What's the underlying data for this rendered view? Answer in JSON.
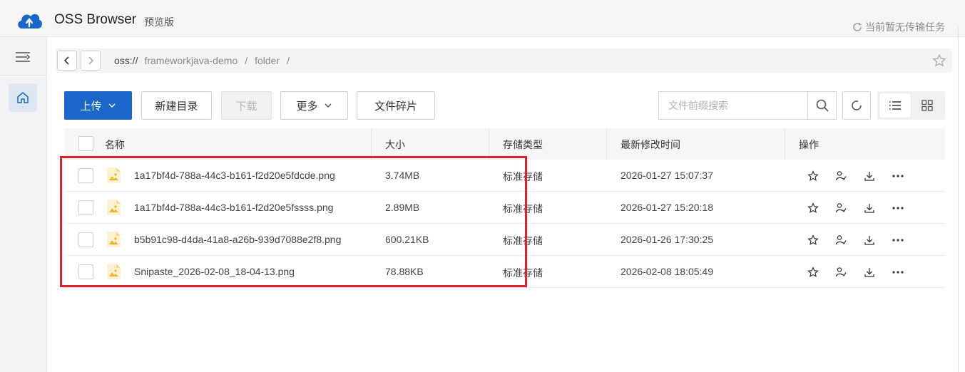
{
  "app": {
    "name": "OSS Browser",
    "tag": "预览版",
    "transfer_status": "当前暂无传输任务",
    "brand_color": "#1a66c9"
  },
  "address": {
    "scheme": "oss://",
    "segments": [
      "frameworkjava-demo",
      "folder"
    ],
    "separator": "/"
  },
  "toolbar": {
    "upload_label": "上传",
    "new_dir_label": "新建目录",
    "download_label": "下载",
    "more_label": "更多",
    "fragments_label": "文件碎片",
    "search_placeholder": "文件前缀搜索"
  },
  "table": {
    "columns": {
      "name": "名称",
      "size": "大小",
      "storage": "存储类型",
      "time": "最新修改时间",
      "actions": "操作"
    },
    "rows": [
      {
        "name": "1a17bf4d-788a-44c3-b161-f2d20e5fdcde.png",
        "size": "3.74MB",
        "storage": "标准存储",
        "time": "2026-01-27 15:07:37"
      },
      {
        "name": "1a17bf4d-788a-44c3-b161-f2d20e5fssss.png",
        "size": "2.89MB",
        "storage": "标准存储",
        "time": "2026-01-27 15:20:18"
      },
      {
        "name": "b5b91c98-d4da-41a8-a26b-939d7088e2f8.png",
        "size": "600.21KB",
        "storage": "标准存储",
        "time": "2026-01-26 17:30:25"
      },
      {
        "name": "Snipaste_2026-02-08_18-04-13.png",
        "size": "78.88KB",
        "storage": "标准存储",
        "time": "2026-02-08 18:05:49"
      }
    ]
  },
  "highlight_color": "#e0202b"
}
